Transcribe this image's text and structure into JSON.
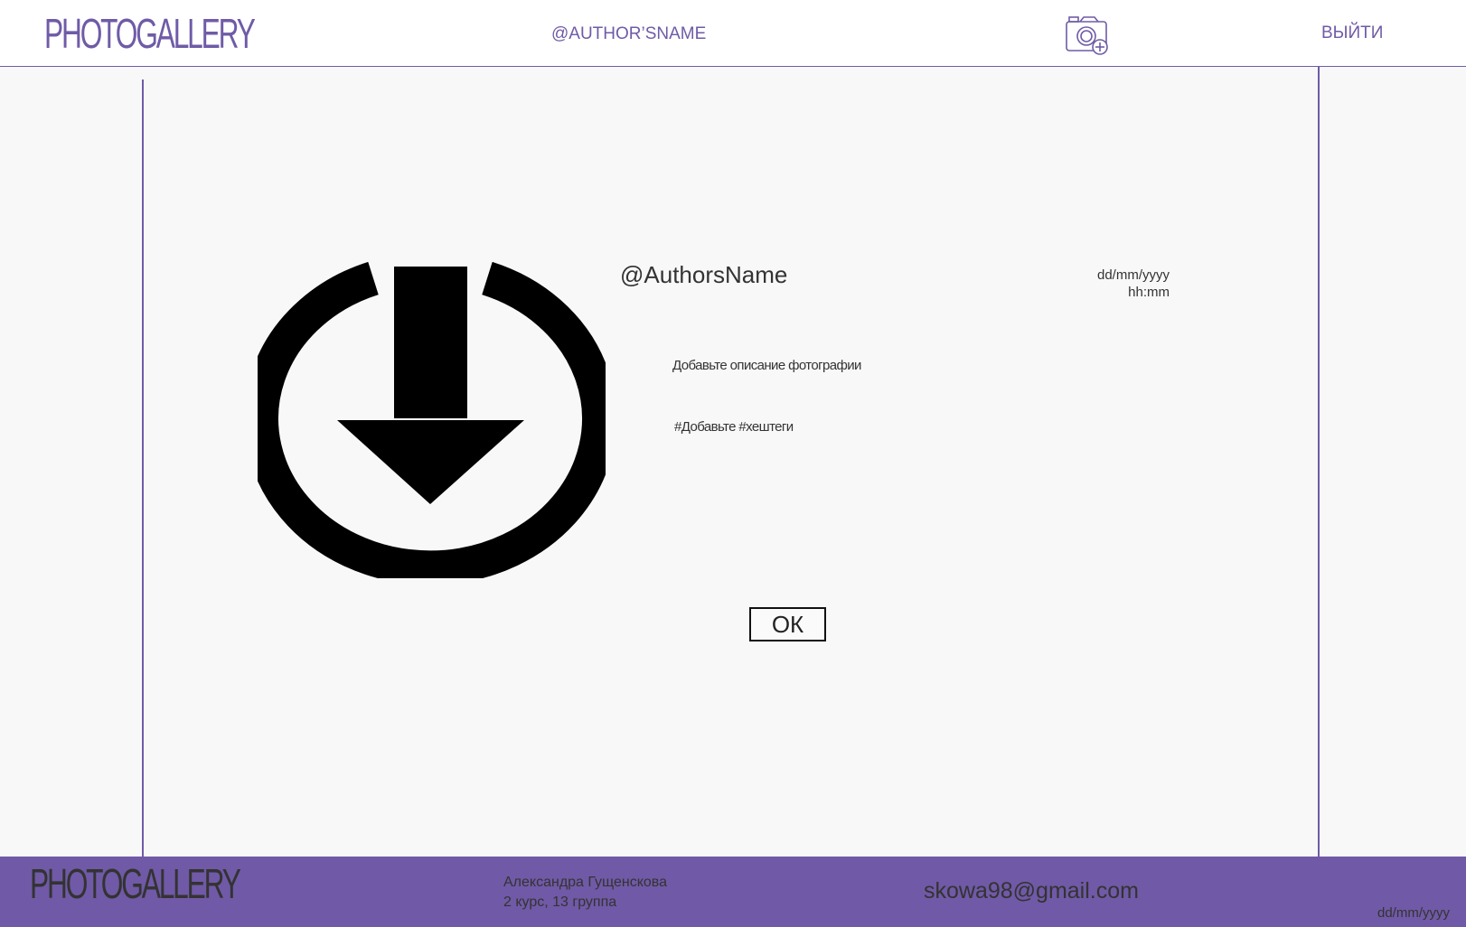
{
  "header": {
    "logo": "PHOTOGALLERY",
    "author_link": "@AUTHOR’SNAME",
    "add_photo_icon": "camera-plus-icon",
    "logout_label": "ВЫЙТИ"
  },
  "upload": {
    "icon": "download-circle-icon"
  },
  "post": {
    "author_name": "@AuthorsName",
    "date": "dd/mm/yyyy",
    "time": "hh:mm",
    "description_placeholder": "Добавьте описание фотографии",
    "hashtags_placeholder": "#Добавьте #хештеги",
    "ok_label": "ОК"
  },
  "footer": {
    "logo": "PHOTOGALLERY",
    "author_full_name": "Александра Гущенскова",
    "author_group": "2 курс, 13 группа",
    "email": "skowa98@gmail.com",
    "date": "dd/mm/yyyy"
  },
  "colors": {
    "accent": "#6f5ba7",
    "footer_bg": "#7059a6",
    "page_bg": "#f8f8f8"
  }
}
